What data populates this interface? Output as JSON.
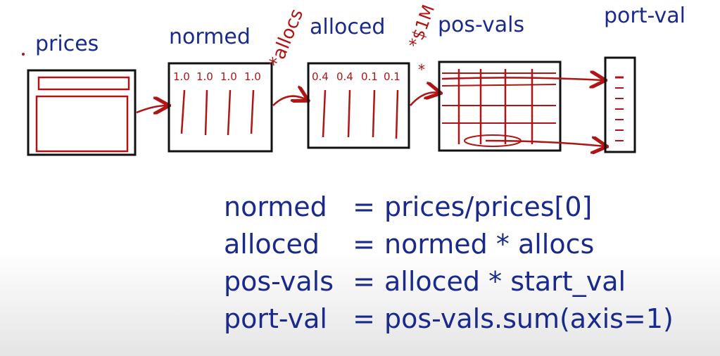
{
  "stages": [
    {
      "label": "prices"
    },
    {
      "label": "normed",
      "column_headers": [
        "1.0",
        "1.0",
        "1.0",
        "1.0"
      ]
    },
    {
      "label": "alloced",
      "column_headers": [
        "0.4",
        "0.4",
        "0.1",
        "0.1"
      ]
    },
    {
      "label": "pos-vals"
    },
    {
      "label": "port-val"
    }
  ],
  "arrow_annotations": {
    "normed_to_alloced": "*allocs",
    "alloced_to_posvals": "*$1M"
  },
  "equations": [
    {
      "lhs": "normed",
      "op": "=",
      "rhs": "prices/prices[0]"
    },
    {
      "lhs": "alloced",
      "op": "=",
      "rhs": "normed * allocs"
    },
    {
      "lhs": "pos-vals",
      "op": "=",
      "rhs": "alloced * start_val"
    },
    {
      "lhs": "port-val",
      "op": "=",
      "rhs": "pos-vals.sum(axis=1)"
    }
  ],
  "colors": {
    "ink_blue": "#1a2a8c",
    "ink_red": "#b01414",
    "ink_black": "#111111"
  }
}
